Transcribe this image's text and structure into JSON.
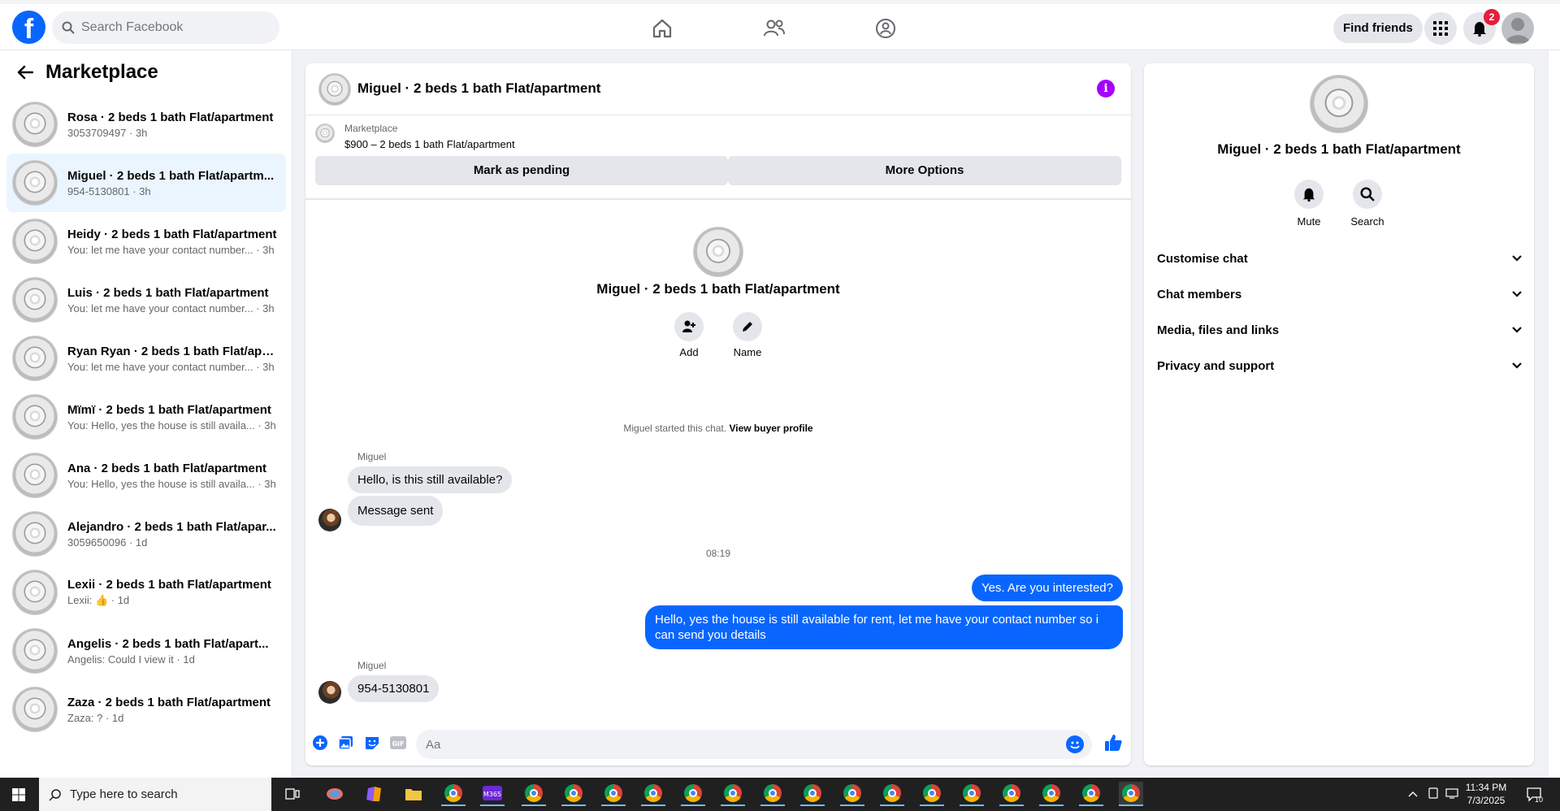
{
  "topnav": {
    "logo": "f",
    "search_placeholder": "Search Facebook",
    "find_friends": "Find friends",
    "notifications_count": "2"
  },
  "sidebar": {
    "title": "Marketplace",
    "conversations": [
      {
        "title": "Rosa · 2 beds 1 bath Flat/apartment",
        "sub": "3053709497 · 3h"
      },
      {
        "title": "Miguel · 2 beds 1 bath Flat/apartm...",
        "sub": "954-5130801 · 3h"
      },
      {
        "title": "Heidy · 2 beds 1 bath Flat/apartment",
        "sub": "You: let me have your contact number... · 3h"
      },
      {
        "title": "Luis · 2 beds 1 bath Flat/apartment",
        "sub": "You: let me have your contact number... · 3h"
      },
      {
        "title": "Ryan Ryan · 2 beds 1 bath Flat/apa...",
        "sub": "You: let me have your contact number... · 3h"
      },
      {
        "title": "Mïmï · 2 beds 1 bath Flat/apartment",
        "sub": "You: Hello, yes the house is still availa... · 3h"
      },
      {
        "title": "Ana · 2 beds 1 bath Flat/apartment",
        "sub": "You: Hello, yes the house is still availa... · 3h"
      },
      {
        "title": "Alejandro · 2 beds 1 bath Flat/apar...",
        "sub": "3059650096 · 1d"
      },
      {
        "title": "Lexii · 2 beds 1 bath Flat/apartment",
        "sub": "Lexii: 👍 · 1d"
      },
      {
        "title": "Angelis · 2 beds 1 bath Flat/apart...",
        "sub": "Angelis: Could I view it · 1d"
      },
      {
        "title": "Zaza · 2 beds 1 bath Flat/apartment",
        "sub": "Zaza: ? · 1d"
      }
    ]
  },
  "chat": {
    "header_name": "Miguel · 2 beds 1 bath Flat/apartment",
    "listing_label": "Marketplace",
    "listing_price": "$900 – 2 beds 1 bath Flat/apartment",
    "mark_pending": "Mark as pending",
    "more_options": "More Options",
    "intro_name": "Miguel · 2 beds 1 bath Flat/apartment",
    "add_label": "Add",
    "name_label": "Name",
    "started_text": "Miguel started this chat.",
    "view_buyer": "View buyer profile",
    "sender1": "Miguel",
    "msg1": "Hello, is this still available?",
    "msg2": "Message sent",
    "time_sep": "08:19",
    "out1": "Yes. Are you interested?",
    "out2": "Hello, yes the house is still available for rent, let me have your contact number so i can send you details",
    "sender2": "Miguel",
    "msg3": "954-5130801",
    "composer_placeholder": "Aa"
  },
  "rpanel": {
    "name": "Miguel · 2 beds 1 bath Flat/apartment",
    "mute": "Mute",
    "search": "Search",
    "sections": [
      "Customise chat",
      "Chat members",
      "Media, files and links",
      "Privacy and support"
    ]
  },
  "taskbar": {
    "search_placeholder": "Type here to search",
    "time": "11:34 PM",
    "date": "7/3/2025",
    "notif_count": "10"
  },
  "colors": {
    "brand": "#0866ff",
    "info": "#a400ff",
    "badge": "#e41e3f"
  }
}
